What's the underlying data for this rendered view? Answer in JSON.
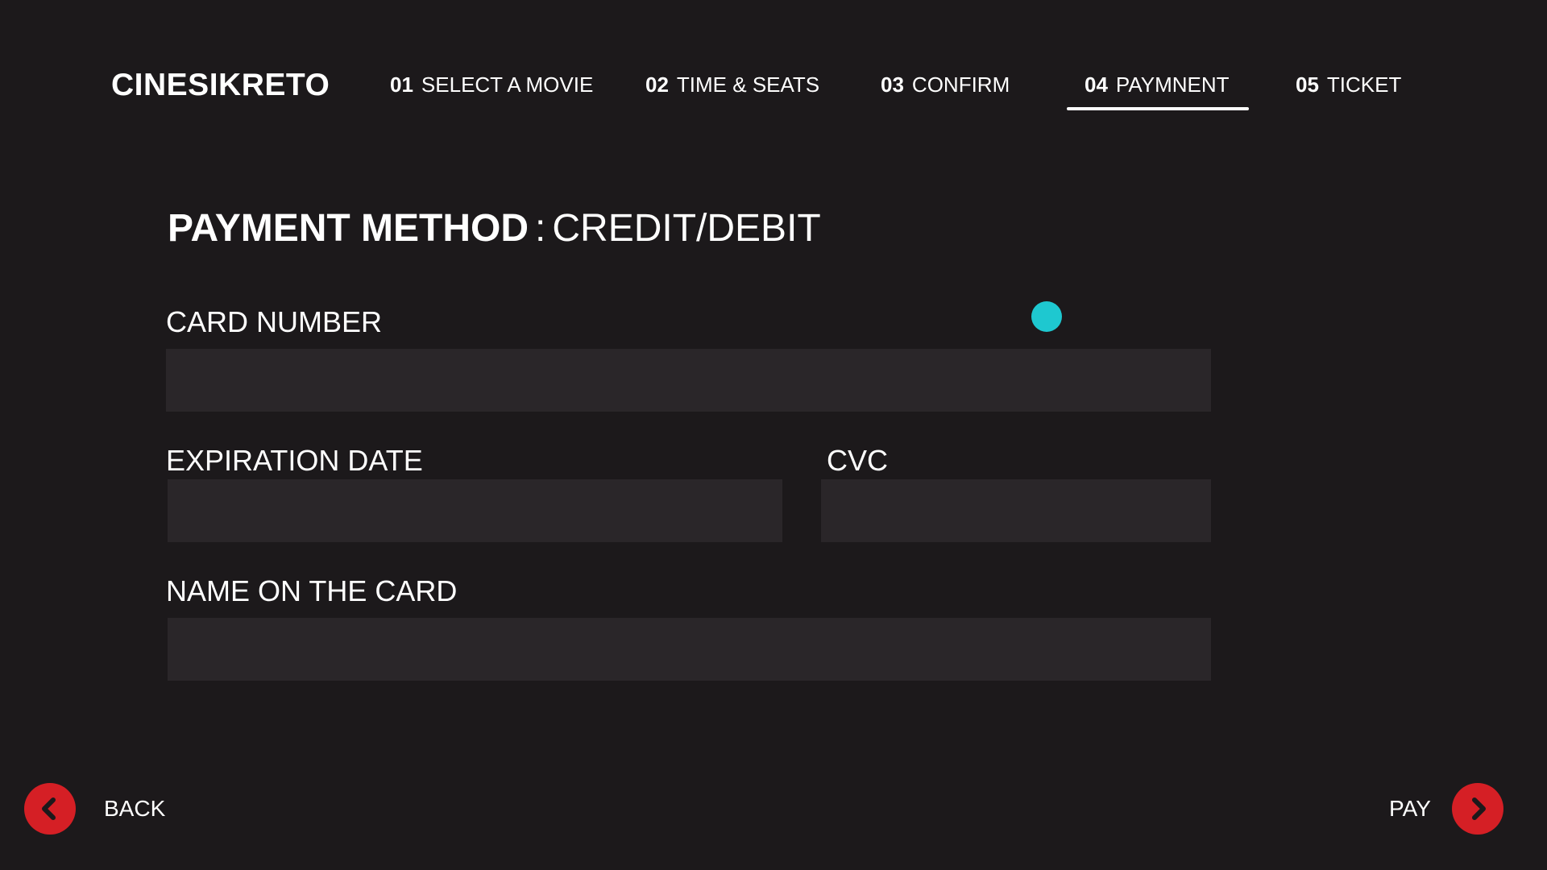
{
  "header": {
    "brand": "CINESIKRETO",
    "steps": [
      {
        "num": "01",
        "label": "SELECT A MOVIE",
        "active": false
      },
      {
        "num": "02",
        "label": "TIME & SEATS",
        "active": false
      },
      {
        "num": "03",
        "label": "CONFIRM",
        "active": false
      },
      {
        "num": "04",
        "label": "PAYMNENT",
        "active": true
      },
      {
        "num": "05",
        "label": "TICKET",
        "active": false
      }
    ]
  },
  "main": {
    "heading_bold": "PAYMENT METHOD",
    "heading_sep": ":",
    "heading_method": "CREDIT/DEBIT",
    "fields": {
      "card_number": {
        "label": "CARD NUMBER",
        "value": ""
      },
      "expiration": {
        "label": "EXPIRATION DATE",
        "value": ""
      },
      "cvc": {
        "label": "CVC",
        "value": ""
      },
      "name": {
        "label": "NAME ON THE CARD",
        "value": ""
      }
    }
  },
  "footer": {
    "back_label": "BACK",
    "pay_label": "PAY",
    "back_icon": "chevron-left-icon",
    "pay_icon": "chevron-right-icon"
  },
  "colors": {
    "background": "#1c191b",
    "input_bg": "#2a2629",
    "accent_red": "#d51f25",
    "cursor_cyan": "#1ec8d0",
    "text": "#ffffff"
  }
}
